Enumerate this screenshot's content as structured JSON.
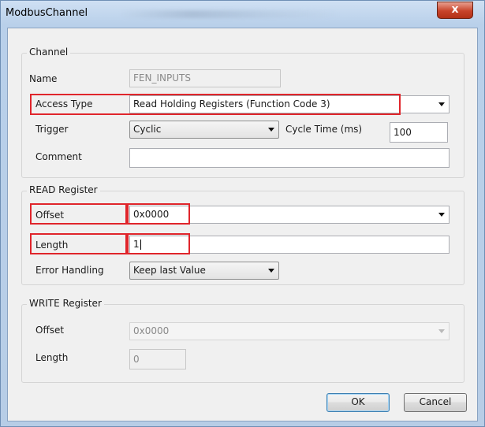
{
  "window": {
    "title": "ModbusChannel",
    "close_label": "x"
  },
  "channel": {
    "group_label": "Channel",
    "name_label": "Name",
    "name_value": "FEN_INPUTS",
    "access_type_label": "Access Type",
    "access_type_value": "Read Holding Registers (Function Code 3)",
    "trigger_label": "Trigger",
    "trigger_value": "Cyclic",
    "cycle_time_label": "Cycle Time (ms)",
    "cycle_time_value": "100",
    "comment_label": "Comment",
    "comment_value": ""
  },
  "read_register": {
    "group_label": "READ Register",
    "offset_label": "Offset",
    "offset_value": "0x0000",
    "length_label": "Length",
    "length_value": "1",
    "error_handling_label": "Error Handling",
    "error_handling_value": "Keep last Value"
  },
  "write_register": {
    "group_label": "WRITE Register",
    "offset_label": "Offset",
    "offset_value": "0x0000",
    "length_label": "Length",
    "length_value": "0"
  },
  "buttons": {
    "ok": "OK",
    "cancel": "Cancel"
  },
  "colors": {
    "highlight": "#e0252b",
    "title_bar": "#b9d0ea",
    "close_button": "#c7432a"
  }
}
